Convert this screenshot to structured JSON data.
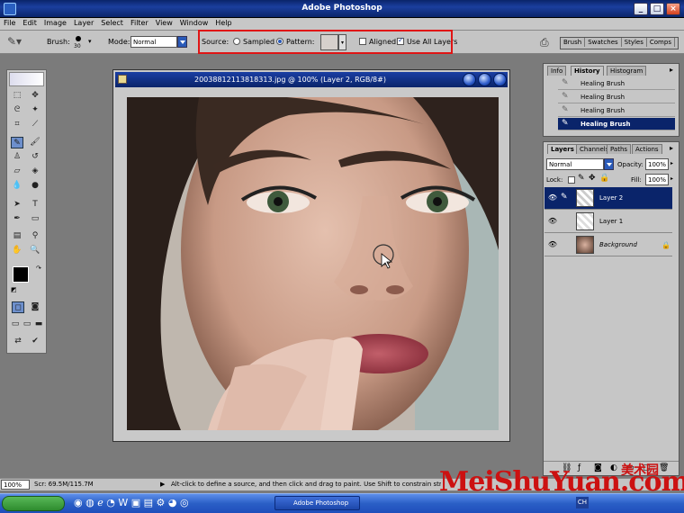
{
  "app": {
    "title": "Adobe Photoshop"
  },
  "menu": [
    "File",
    "Edit",
    "Image",
    "Layer",
    "Select",
    "Filter",
    "View",
    "Window",
    "Help"
  ],
  "options": {
    "brush_label": "Brush:",
    "brush_size": "30",
    "mode_label": "Mode:",
    "mode_value": "Normal",
    "source_label": "Source:",
    "sampled_label": "Sampled",
    "pattern_label": "Pattern:",
    "aligned_label": "Aligned",
    "use_all_layers_label": "Use All Layers",
    "sampled_selected": false,
    "pattern_selected": true,
    "aligned_checked": false,
    "use_all_layers_checked": true,
    "palette_tabs": [
      "Brush",
      "Swatches",
      "Styles",
      "Comps"
    ]
  },
  "document": {
    "title": "20038812113818313.jpg @ 100% (Layer 2, RGB/8#)"
  },
  "history_panel": {
    "tabs": [
      "Info",
      "History",
      "Histogram"
    ],
    "active_tab": "History",
    "states": [
      "Healing Brush",
      "Healing Brush",
      "Healing Brush",
      "Healing Brush"
    ],
    "selected_index": 3
  },
  "layers_panel": {
    "tabs": [
      "Layers",
      "Channels",
      "Paths",
      "Actions"
    ],
    "active_tab": "Layers",
    "blend_mode": "Normal",
    "opacity_label": "Opacity:",
    "opacity_value": "100%",
    "lock_label": "Lock:",
    "fill_label": "Fill:",
    "fill_value": "100%",
    "layers": [
      "Layer 2",
      "Layer 1",
      "Background"
    ],
    "selected_index": 0
  },
  "status": {
    "zoom": "100%",
    "scratch": "Scr: 69.5M/115.7M",
    "hint": "Alt-click to define a source, and then click and drag to paint. Use Shift to constrain stroke"
  },
  "taskbar": {
    "active_app": "Adobe Photoshop",
    "language": "CH"
  },
  "watermark": {
    "text": "MeiShuYuan.com",
    "cn": "美术园"
  },
  "colors": {
    "highlight_box": "#e01515",
    "selection": "#0a246a"
  }
}
